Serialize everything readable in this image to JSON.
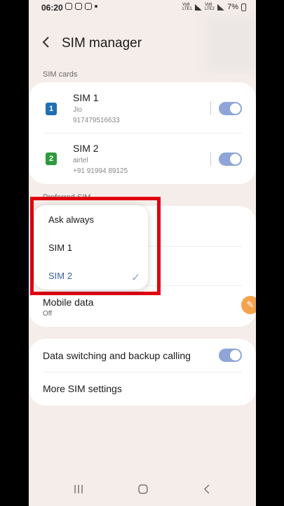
{
  "status_bar": {
    "time": "06:20",
    "network_label_1": "Vo8 LTE1",
    "network_label_2": "Vo8 LTE2",
    "battery": "7%"
  },
  "header": {
    "back_icon": "chevron-left-icon",
    "title": "SIM manager"
  },
  "sim_cards": {
    "section_label": "SIM cards",
    "items": [
      {
        "badge": "1",
        "name": "SIM 1",
        "carrier": "Jio",
        "number": "917479516633",
        "badge_color": "#1e6fb5",
        "enabled": true
      },
      {
        "badge": "2",
        "name": "SIM 2",
        "carrier": "airtel",
        "number": "+91 91994 89125",
        "badge_color": "#2f9a3d",
        "enabled": true
      }
    ]
  },
  "preferred_sim": {
    "section_label_partial": "Preferred SIM",
    "mobile_data": {
      "title": "Mobile data",
      "value": "Off"
    }
  },
  "dropdown": {
    "options": [
      "Ask always",
      "SIM 1",
      "SIM 2"
    ],
    "selected": "SIM 2",
    "highlight_color": "#e00010"
  },
  "more": {
    "data_switching": {
      "label": "Data switching and backup calling",
      "enabled": true
    },
    "more_sim_settings": "More SIM settings"
  },
  "colors": {
    "accent": "#3a5fae",
    "toggle_on": "#8fa5d7",
    "background": "#f5edea"
  }
}
